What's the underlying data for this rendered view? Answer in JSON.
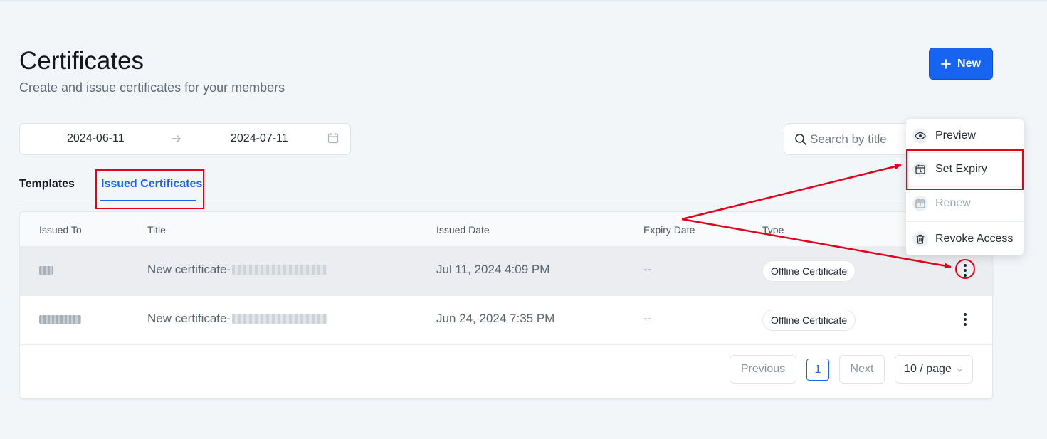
{
  "header": {
    "title": "Certificates",
    "subtitle": "Create and issue certificates for your members",
    "new_label": "New"
  },
  "filters": {
    "date_start": "2024-06-11",
    "date_end": "2024-07-11",
    "search_placeholder": "Search by title"
  },
  "tabs": [
    {
      "label": "Templates",
      "active": false
    },
    {
      "label": "Issued Certificates",
      "active": true
    }
  ],
  "table": {
    "columns": [
      "Issued To",
      "Title",
      "Issued Date",
      "Expiry Date",
      "Type"
    ],
    "rows": [
      {
        "title_prefix": "New certificate-",
        "issued_date": "Jul 11, 2024 4:09 PM",
        "expiry": "--",
        "type": "Offline Certificate"
      },
      {
        "title_prefix": "New certificate-",
        "issued_date": "Jun 24, 2024 7:35 PM",
        "expiry": "--",
        "type": "Offline Certificate"
      }
    ]
  },
  "pagination": {
    "previous": "Previous",
    "page": "1",
    "next": "Next",
    "page_size": "10 / page"
  },
  "menu": {
    "items": [
      {
        "label": "Preview",
        "icon": "eye-icon",
        "disabled": false
      },
      {
        "label": "Set Expiry",
        "icon": "calendar-clock-icon",
        "disabled": false
      },
      {
        "label": "Renew",
        "icon": "calendar-refresh-icon",
        "disabled": true
      },
      {
        "label": "Revoke Access",
        "icon": "trash-icon",
        "disabled": false
      }
    ]
  },
  "colors": {
    "primary": "#1764f0",
    "annotation": "#e3001b",
    "background": "#f2f6f9"
  }
}
